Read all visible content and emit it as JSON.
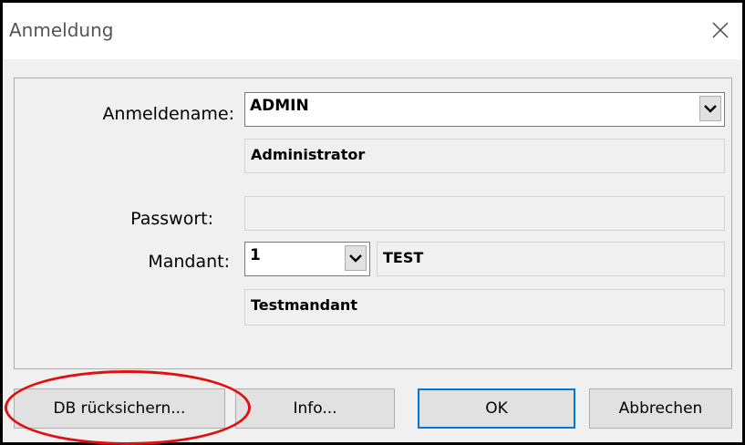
{
  "window": {
    "title": "Anmeldung"
  },
  "fields": {
    "login_label": "Anmeldename:",
    "login_value": "ADMIN",
    "login_fullname": "Administrator",
    "password_label": "Passwort:",
    "password_value": "",
    "client_label": "Mandant:",
    "client_value": "1",
    "client_code": "TEST",
    "client_name": "Testmandant"
  },
  "buttons": {
    "restore_label": "DB rücksichern...",
    "info_label": "Info...",
    "ok_label": "OK",
    "cancel_label": "Abbrechen"
  },
  "icons": {
    "close": "close-icon",
    "dropdown": "chevron-down-icon"
  },
  "colors": {
    "highlight": "#e01010",
    "default_button_border": "#0078d7"
  }
}
